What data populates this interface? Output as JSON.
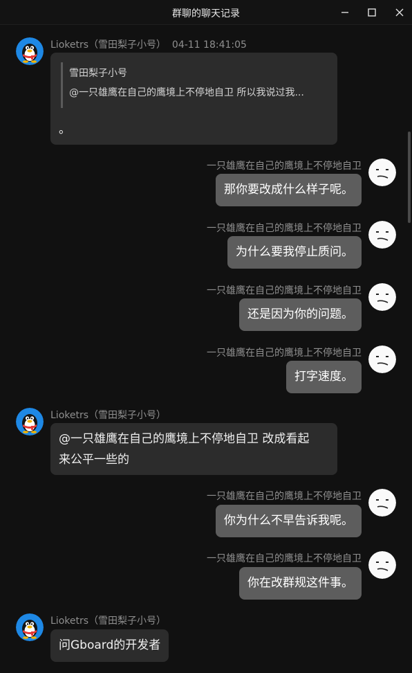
{
  "window": {
    "title": "群聊的聊天记录",
    "minimize_icon": "minimize-icon",
    "maximize_icon": "maximize-icon",
    "close_icon": "close-icon"
  },
  "messages": [
    {
      "side": "left",
      "sender": "Lioketrs（雪田梨子小号）",
      "time": "04-11 18:41:05",
      "quote": {
        "title": "雪田梨子小号",
        "text": "@一只雄鹰在自己的鹰境上不停地自卫 所以我说过我..."
      },
      "text": "。"
    },
    {
      "side": "right",
      "sender": "一只雄鹰在自己的鹰境上不停地自卫",
      "text": "那你要改成什么样子呢。"
    },
    {
      "side": "right",
      "sender": "一只雄鹰在自己的鹰境上不停地自卫",
      "text": "为什么要我停止质问。"
    },
    {
      "side": "right",
      "sender": "一只雄鹰在自己的鹰境上不停地自卫",
      "text": "还是因为你的问题。"
    },
    {
      "side": "right",
      "sender": "一只雄鹰在自己的鹰境上不停地自卫",
      "text": "打字速度。"
    },
    {
      "side": "left",
      "sender": "Lioketrs（雪田梨子小号）",
      "line1": "@一只雄鹰在自己的鹰境上不停地自卫 改成看起",
      "line2": "来公平一些的"
    },
    {
      "side": "right",
      "sender": "一只雄鹰在自己的鹰境上不停地自卫",
      "text": "你为什么不早告诉我呢。"
    },
    {
      "side": "right",
      "sender": "一只雄鹰在自己的鹰境上不停地自卫",
      "text": "你在改群规这件事。"
    },
    {
      "side": "left",
      "sender": "Lioketrs（雪田梨子小号）",
      "text": "问Gboard的开发者"
    }
  ],
  "colors": {
    "background": "#111111",
    "left_bubble": "#2c2c2c",
    "right_bubble": "#5d5d5d",
    "meta_text": "#8f8f8f"
  }
}
